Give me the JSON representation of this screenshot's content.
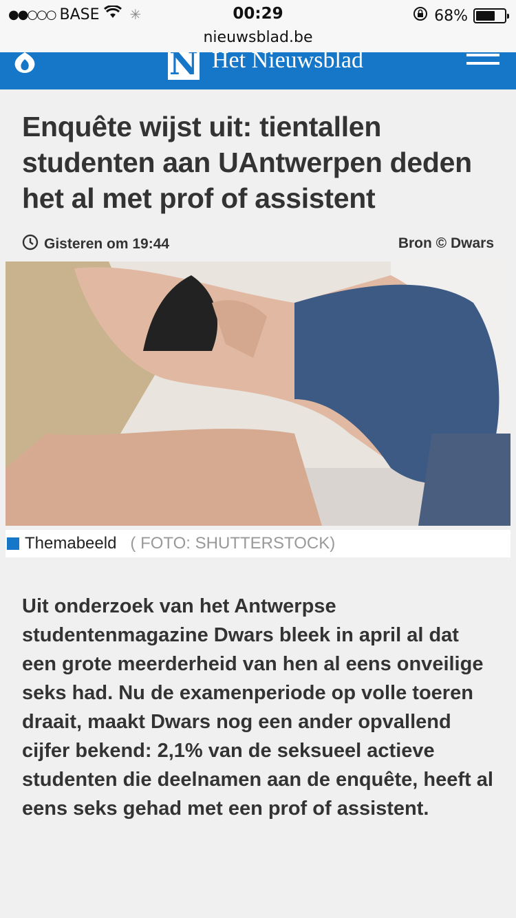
{
  "status_bar": {
    "signal_dots": "●●○○○",
    "carrier": "BASE",
    "time": "00:29",
    "battery_percent": "68%",
    "battery_level": 0.68
  },
  "url_bar": {
    "domain": "nieuwsblad.be"
  },
  "header": {
    "logo_letter": "N",
    "logo_text": "Het Nieuwsblad",
    "brand_color": "#1677c9"
  },
  "article": {
    "headline": "Enquête wijst uit: tientallen studenten aan UAntwerpen deden het al met prof of assistent",
    "timestamp": "Gisteren om 19:44",
    "source": "Bron © Dwars",
    "caption_label": "Themabeeld",
    "caption_credit": "( FOTO: SHUTTERSTOCK)",
    "body": "Uit onderzoek van het Antwerpse studentenmagazine Dwars bleek in april al dat een grote meerderheid van hen al eens onveilige seks had. Nu de examenperiode op volle toeren draait, maakt Dwars nog een ander opvallend cijfer bekend: 2,1% van de seksueel actieve studenten die deelnamen aan de enquête, heeft al eens seks gehad met een prof of assistent."
  }
}
